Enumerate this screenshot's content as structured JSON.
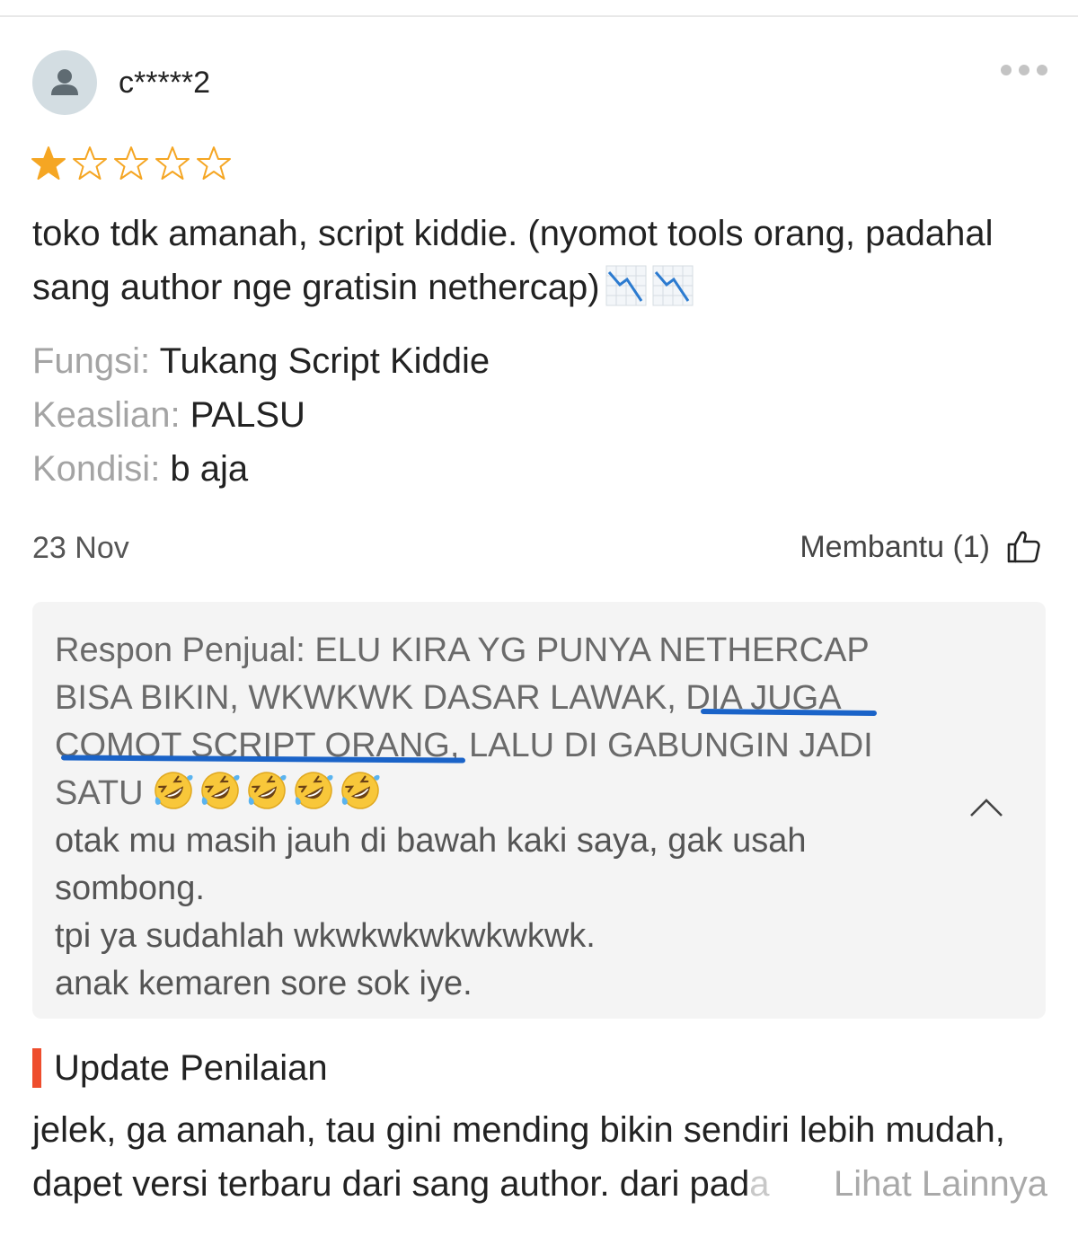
{
  "review": {
    "username": "c*****2",
    "rating": 1,
    "max_rating": 5,
    "text_line1": "toko tdk amanah, script kiddie. (nyomot tools orang, padahal",
    "text_line2": "sang author nge gratisin nethercap)",
    "emoji_chart": "chart-decreasing-icon",
    "attributes": [
      {
        "key": "Fungsi:",
        "value": " Tukang Script Kiddie"
      },
      {
        "key": "Keaslian:",
        "value": " PALSU"
      },
      {
        "key": "Kondisi:",
        "value": " b aja"
      }
    ],
    "date": "23 Nov",
    "helpful_label": "Membantu (1)"
  },
  "seller_response": {
    "line1": "Respon Penjual: ELU KIRA YG PUNYA NETHERCAP",
    "line2": "BISA BIKIN, WKWKWK DASAR LAWAK, DIA JUGA",
    "line3": "COMOT SCRIPT ORANG, LALU DI GABUNGIN JADI",
    "line4": "SATU ",
    "line5": "otak mu masih jauh di bawah kaki saya, gak usah",
    "line6": "sombong.",
    "line7": "tpi ya sudahlah wkwkwkwkwkwkwk.",
    "line8": "anak kemaren sore sok iye.",
    "emoji": "rolling-on-floor-laughing-icon",
    "emoji_count": 5,
    "underline_color": "#1a63c8"
  },
  "update": {
    "title": "Update Penilaian",
    "line1": "jelek, ga amanah, tau gini mending bikin sendiri lebih mudah,",
    "line2_main": "dapet versi terbaru dari sang author. dari pad",
    "line2_fade": "a",
    "see_more": "Lihat Lainnya",
    "accent_color": "#ee4d2d"
  },
  "colors": {
    "star": "#f5a623",
    "muted_text": "#a4a4a4"
  }
}
